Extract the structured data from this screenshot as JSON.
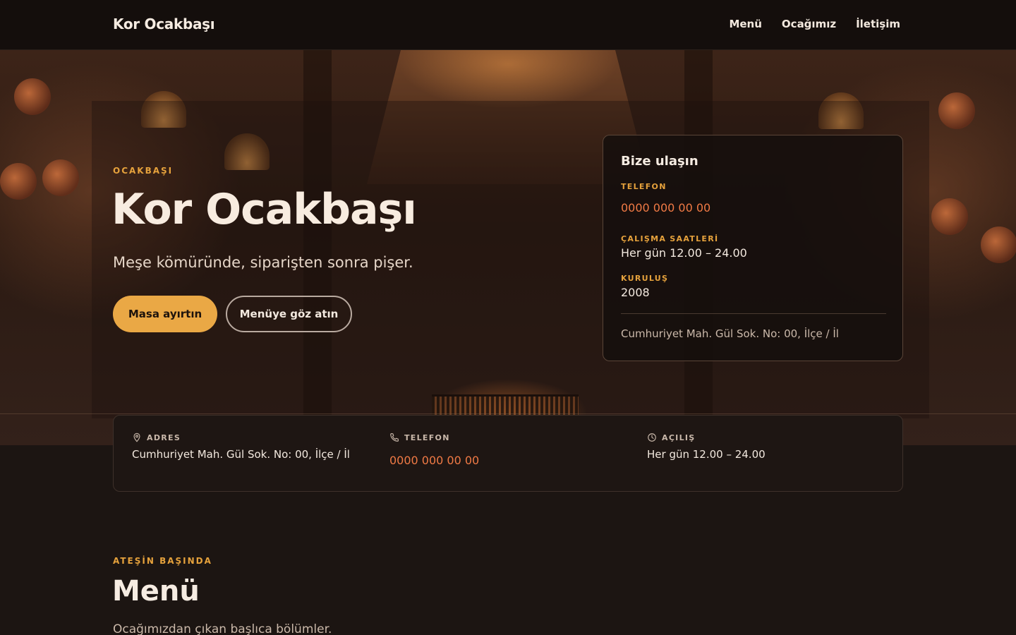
{
  "nav": {
    "brand": "Kor Ocakbaşı",
    "links": [
      "Menü",
      "Ocağımız",
      "İletişim"
    ]
  },
  "hero": {
    "eyebrow": "OCAKBAŞI",
    "title": "Kor Ocakbaşı",
    "subtitle": "Meşe kömüründe, siparişten sonra pişer.",
    "primary_button": "Masa ayırtın",
    "secondary_button": "Menüye göz atın"
  },
  "contact_card": {
    "title": "Bize ulaşın",
    "phone_label": "TELEFON",
    "phone": "0000 000 00 00",
    "hours_label": "ÇALIŞMA SAATLERİ",
    "hours": "Her gün 12.00 – 24.00",
    "founded_label": "KURULUŞ",
    "founded": "2008",
    "address": "Cumhuriyet Mah. Gül Sok. No: 00, İlçe / İl"
  },
  "info_strip": {
    "address_label": "ADRES",
    "address": "Cumhuriyet Mah. Gül Sok. No: 00, İlçe / İl",
    "phone_label": "TELEFON",
    "phone": "0000 000 00 00",
    "opening_label": "AÇILIŞ",
    "opening": "Her gün 12.00 – 24.00"
  },
  "menu_section": {
    "eyebrow": "ATEŞİN BAŞINDA",
    "title": "Menü",
    "subtitle": "Ocağımızdan çıkan başlıca bölümler."
  },
  "colors": {
    "accent": "#e6a23c",
    "button": "#eaa845",
    "phone": "#f07a45",
    "background": "#1c1512"
  },
  "icons": [
    "map-pin-icon",
    "phone-icon",
    "clock-icon"
  ]
}
